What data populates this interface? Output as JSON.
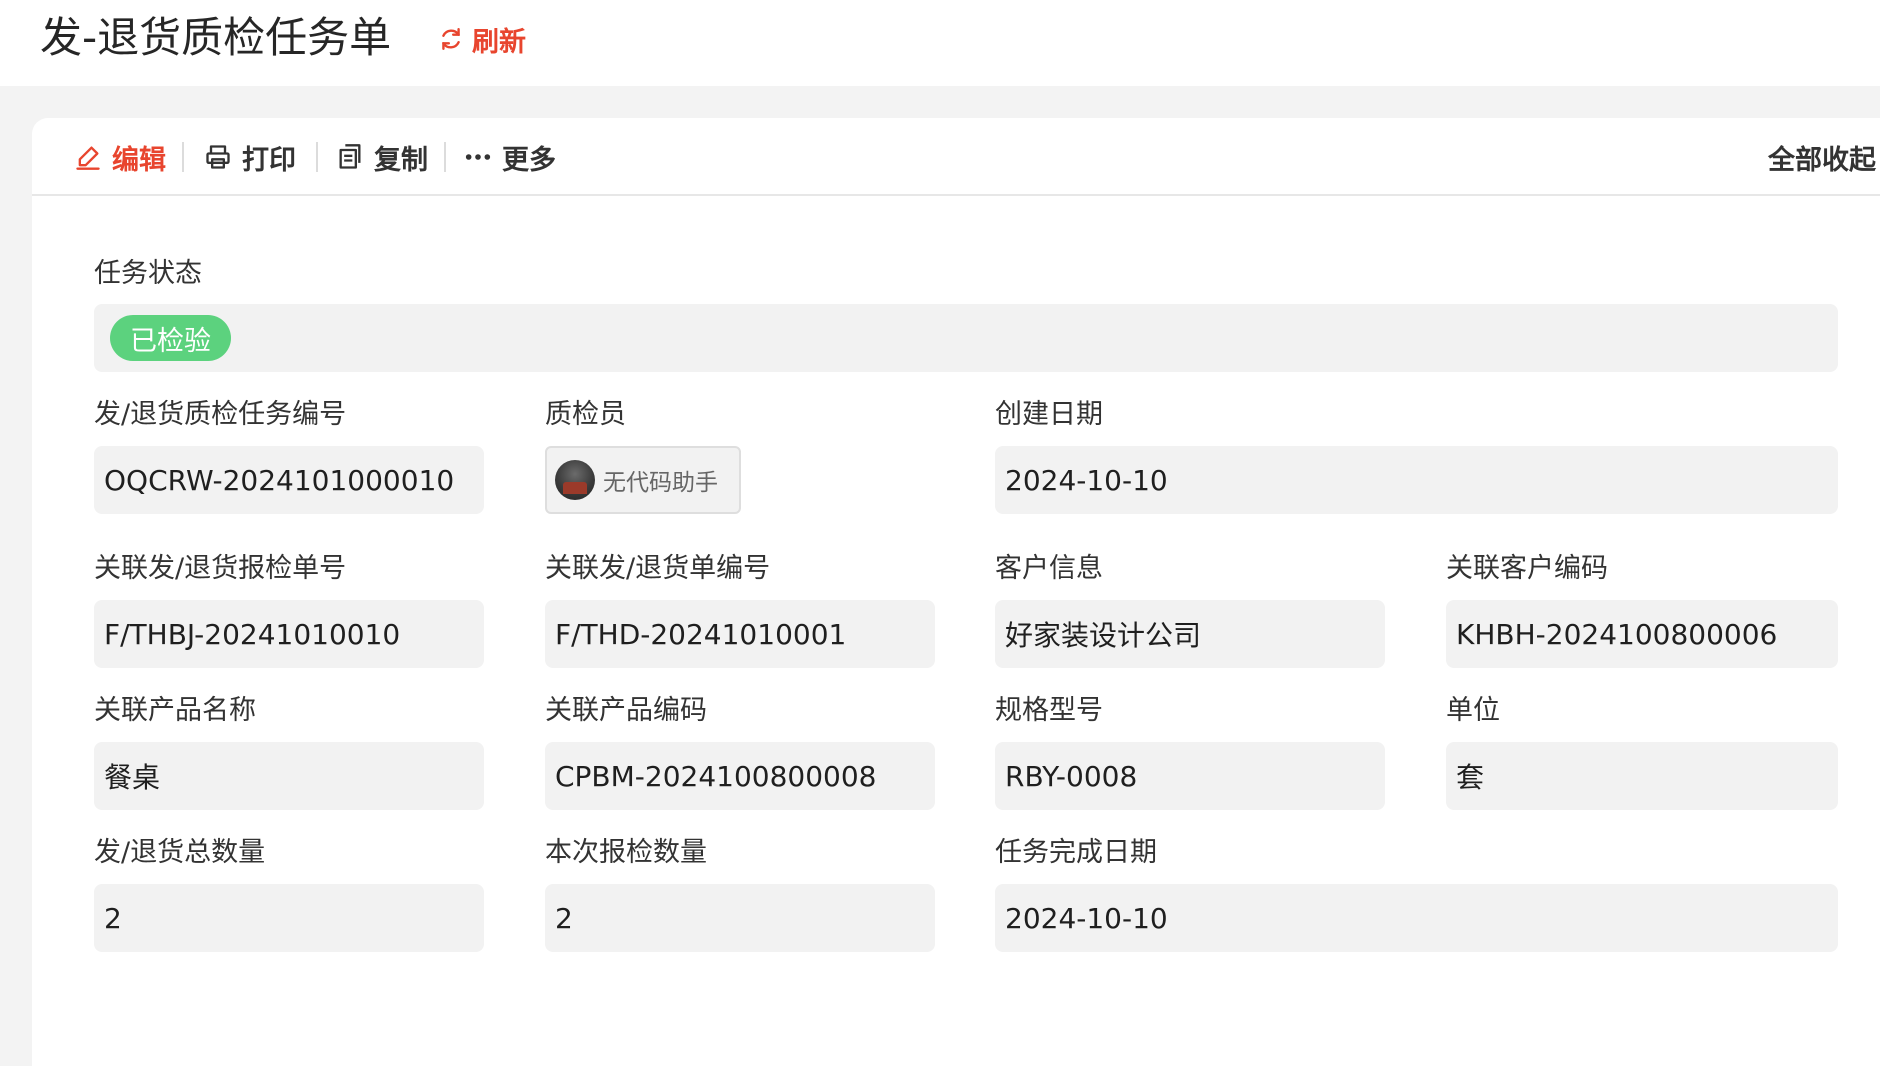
{
  "header": {
    "title": "发-退货质检任务单",
    "refresh_label": "刷新"
  },
  "toolbar": {
    "edit_label": "编辑",
    "print_label": "打印",
    "copy_label": "复制",
    "more_label": "更多",
    "collapse_all_label": "全部收起"
  },
  "form": {
    "task_status": {
      "label": "任务状态",
      "value": "已检验",
      "badge_color": "#5cd27e"
    },
    "task_no": {
      "label": "发/退货质检任务编号",
      "value": "OQCRW-2024101000010"
    },
    "inspector": {
      "label": "质检员",
      "value": "无代码助手"
    },
    "create_date": {
      "label": "创建日期",
      "value": "2024-10-10"
    },
    "report_no": {
      "label": "关联发/退货报检单号",
      "value": "F/THBJ-20241010010"
    },
    "order_no": {
      "label": "关联发/退货单编号",
      "value": "F/THD-20241010001"
    },
    "customer": {
      "label": "客户信息",
      "value": "好家装设计公司"
    },
    "customer_code": {
      "label": "关联客户编码",
      "value": "KHBH-2024100800006"
    },
    "product_name": {
      "label": "关联产品名称",
      "value": "餐桌"
    },
    "product_code": {
      "label": "关联产品编码",
      "value": "CPBM-2024100800008"
    },
    "spec": {
      "label": "规格型号",
      "value": "RBY-0008"
    },
    "unit": {
      "label": "单位",
      "value": "套"
    },
    "total_qty": {
      "label": "发/退货总数量",
      "value": "2"
    },
    "inspect_qty": {
      "label": "本次报检数量",
      "value": "2"
    },
    "finish_date": {
      "label": "任务完成日期",
      "value": "2024-10-10"
    }
  },
  "colors": {
    "accent": "#e8452e",
    "field_bg": "#f2f2f2",
    "page_bg": "#f3f3f3"
  }
}
